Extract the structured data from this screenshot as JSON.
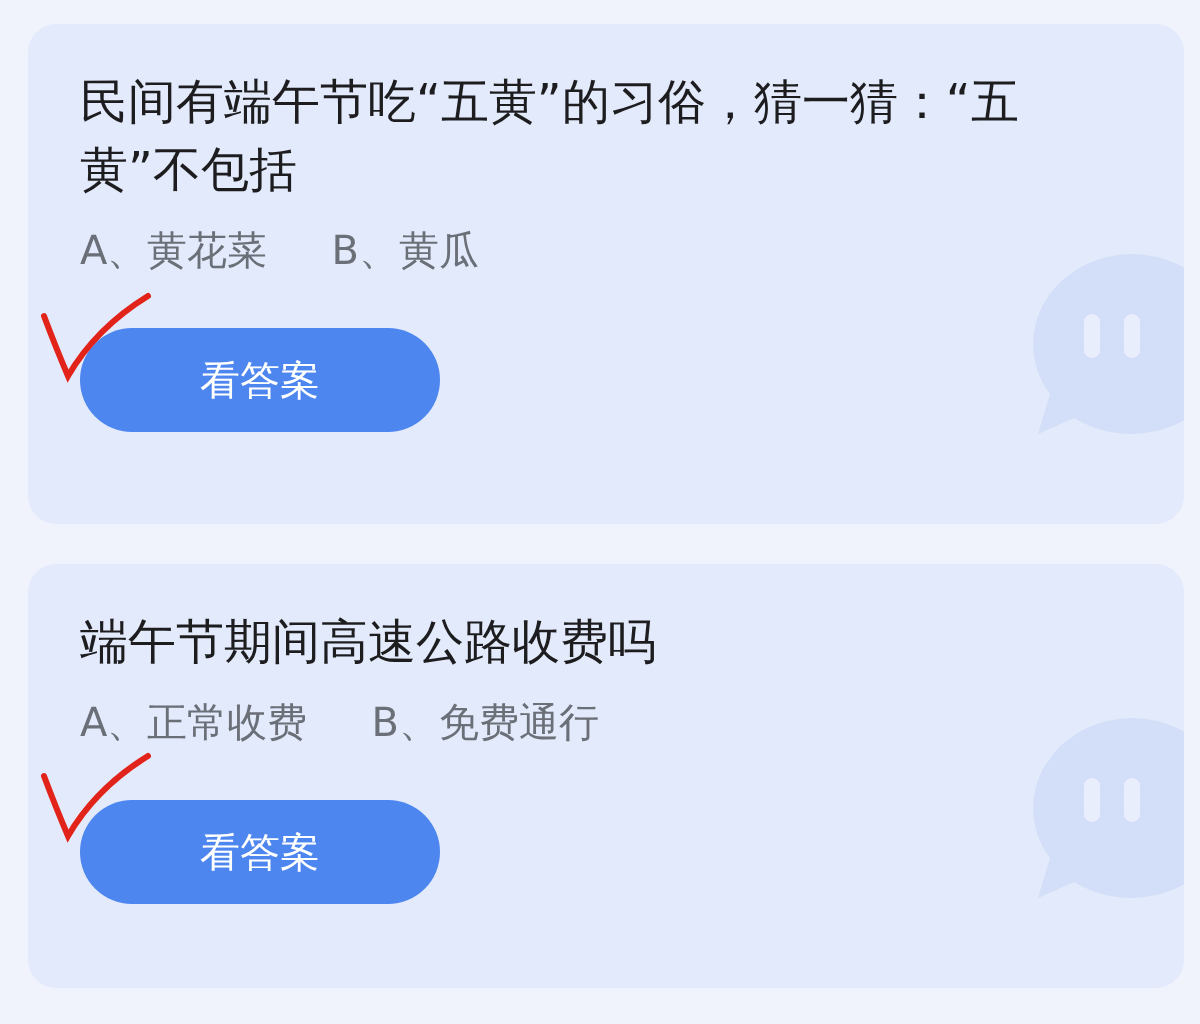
{
  "questions": [
    {
      "question": "民间有端午节吃“五黄”的习俗，猜一猜：“五黄”不包括",
      "options": [
        "A、黄花菜",
        "B、黄瓜"
      ],
      "hand_check": true,
      "button": "看答案"
    },
    {
      "question": "端午节期间高速公路收费吗",
      "options": [
        "A、正常收费",
        "B、免费通行"
      ],
      "hand_check": true,
      "button": "看答案"
    }
  ]
}
